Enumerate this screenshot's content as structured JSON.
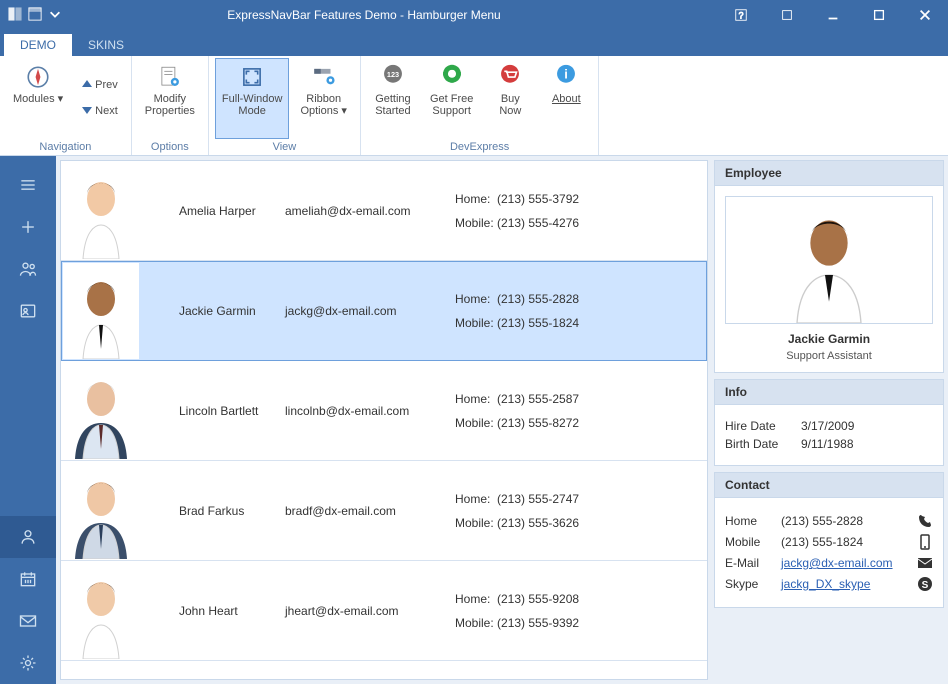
{
  "window": {
    "title": "ExpressNavBar Features Demo - Hamburger Menu"
  },
  "tabs": {
    "demo": "DEMO",
    "skins": "SKINS"
  },
  "ribbon": {
    "navigation": {
      "caption": "Navigation",
      "modules": "Modules",
      "prev": "Prev",
      "next": "Next"
    },
    "options": {
      "caption": "Options",
      "modify": "Modify\nProperties"
    },
    "view": {
      "caption": "View",
      "full": "Full-Window\nMode",
      "ribbon": "Ribbon\nOptions"
    },
    "devexpress": {
      "caption": "DevExpress",
      "getting": "Getting\nStarted",
      "support": "Get Free\nSupport",
      "buy": "Buy\nNow",
      "about": "About"
    }
  },
  "employees": [
    {
      "name": "Amelia Harper",
      "email": "ameliah@dx-email.com",
      "home_label": "Home:",
      "home": "(213) 555-3792",
      "mobile_label": "Mobile:",
      "mobile": "(213) 555-4276",
      "skin": "#f2c9a5",
      "hair": "#4a2b14",
      "shirt": "#ffffff",
      "tie": "none"
    },
    {
      "name": "Jackie Garmin",
      "email": "jackg@dx-email.com",
      "home_label": "Home:",
      "home": "(213) 555-2828",
      "mobile_label": "Mobile:",
      "mobile": "(213) 555-1824",
      "skin": "#a87247",
      "hair": "#1c120b",
      "shirt": "#ffffff",
      "tie": "#111"
    },
    {
      "name": "Lincoln Bartlett",
      "email": "lincolnb@dx-email.com",
      "home_label": "Home:",
      "home": "(213) 555-2587",
      "mobile_label": "Mobile:",
      "mobile": "(213) 555-8272",
      "skin": "#e9c0a0",
      "hair": "#bdbdbd",
      "shirt": "#dce6f2",
      "tie": "#5b2b2b",
      "jacket": "#31455f"
    },
    {
      "name": "Brad Farkus",
      "email": "bradf@dx-email.com",
      "home_label": "Home:",
      "home": "(213) 555-2747",
      "mobile_label": "Mobile:",
      "mobile": "(213) 555-3626",
      "skin": "#efc7a5",
      "hair": "#4a2b14",
      "shirt": "#cfd9e6",
      "tie": "#2a3e5b",
      "jacket": "#3b4f6b"
    },
    {
      "name": "John Heart",
      "email": "jheart@dx-email.com",
      "home_label": "Home:",
      "home": "(213) 555-9208",
      "mobile_label": "Mobile:",
      "mobile": "(213) 555-9392",
      "skin": "#f0caa8",
      "hair": "#4a2b14",
      "shirt": "#ffffff",
      "tie": "none"
    }
  ],
  "detail": {
    "employee_h": "Employee",
    "name": "Jackie Garmin",
    "title": "Support Assistant",
    "info_h": "Info",
    "hire_k": "Hire Date",
    "hire_v": "3/17/2009",
    "birth_k": "Birth Date",
    "birth_v": "9/11/1988",
    "contact_h": "Contact",
    "home_k": "Home",
    "home_v": "(213) 555-2828",
    "mobile_k": "Mobile",
    "mobile_v": "(213) 555-1824",
    "email_k": "E-Mail",
    "email_v": "jackg@dx-email.com",
    "skype_k": "Skype",
    "skype_v": "jackg_DX_skype"
  }
}
